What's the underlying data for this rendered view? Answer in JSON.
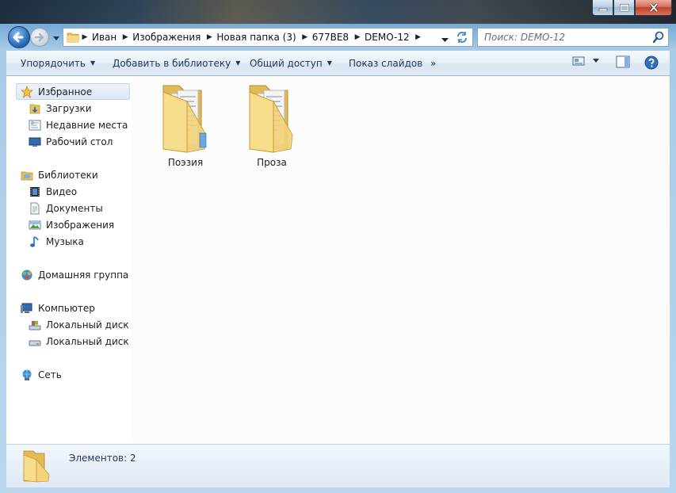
{
  "window": {
    "caption": {
      "minimize": "minimize",
      "maximize": "maximize",
      "close": "close"
    }
  },
  "navigation": {
    "breadcrumb": [
      "Иван",
      "Изображения",
      "Новая папка (3)",
      "677BE8",
      "DEMO-12"
    ],
    "search_placeholder": "Поиск: DEMO-12"
  },
  "toolbar": {
    "organize": "Упорядочить",
    "add_to_library": "Добавить в библиотеку",
    "share": "Общий доступ",
    "slideshow": "Показ слайдов",
    "more": "»"
  },
  "sidebar": {
    "favorites": {
      "label": "Избранное",
      "items": [
        "Загрузки",
        "Недавние места",
        "Рабочий стол"
      ]
    },
    "libraries": {
      "label": "Библиотеки",
      "items": [
        "Видео",
        "Документы",
        "Изображения",
        "Музыка"
      ]
    },
    "homegroup": {
      "label": "Домашняя группа"
    },
    "computer": {
      "label": "Компьютер",
      "items": [
        "Локальный диск (C:)",
        "Локальный диск (D:)"
      ]
    },
    "network": {
      "label": "Сеть"
    }
  },
  "files": [
    {
      "name": "Поэзия",
      "type": "folder"
    },
    {
      "name": "Проза",
      "type": "folder"
    }
  ],
  "status": {
    "item_count": "Элементов: 2"
  },
  "colors": {
    "toolbar_text": "#1e395b",
    "folder_yellow": "#f2d27a",
    "selection": "#dce7f4"
  }
}
